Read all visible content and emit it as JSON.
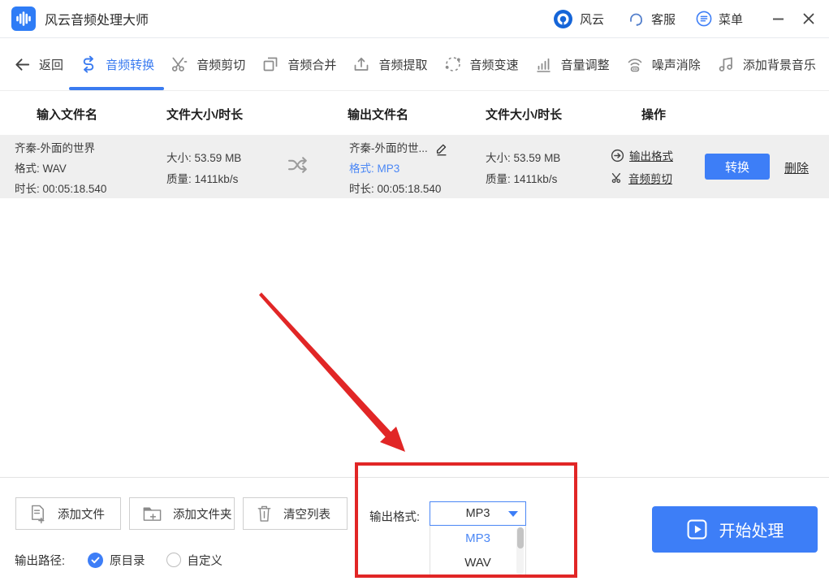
{
  "titlebar": {
    "app_title": "风云音频处理大师",
    "brand": "风云",
    "support": "客服",
    "menu": "菜单"
  },
  "tabs": {
    "back": "返回",
    "items": [
      {
        "label": "音频转换",
        "active": true
      },
      {
        "label": "音频剪切",
        "active": false
      },
      {
        "label": "音频合并",
        "active": false
      },
      {
        "label": "音频提取",
        "active": false
      },
      {
        "label": "音频变速",
        "active": false
      },
      {
        "label": "音量调整",
        "active": false
      },
      {
        "label": "噪声消除",
        "active": false
      },
      {
        "label": "添加背景音乐",
        "active": false
      }
    ]
  },
  "table": {
    "headers": [
      "输入文件名",
      "文件大小/时长",
      "输出文件名",
      "文件大小/时长",
      "操作"
    ],
    "row": {
      "input": {
        "name": "齐秦-外面的世界",
        "format_label": "格式:",
        "format": "WAV",
        "duration_label": "时长:",
        "duration": "00:05:18.540",
        "size_label": "大小:",
        "size": "53.59 MB",
        "quality_label": "质量:",
        "quality": "1411kb/s"
      },
      "output": {
        "name": "齐秦-外面的世...",
        "format_label": "格式:",
        "format": "MP3",
        "duration_label": "时长:",
        "duration": "00:05:18.540",
        "size_label": "大小:",
        "size": "53.59 MB",
        "quality_label": "质量:",
        "quality": "1411kb/s"
      },
      "actions": {
        "output_format": "输出格式",
        "audio_cut": "音频剪切",
        "convert": "转换",
        "delete": "删除"
      }
    }
  },
  "footer": {
    "add_file": "添加文件",
    "add_folder": "添加文件夹",
    "clear_list": "清空列表",
    "output_format_label": "输出格式:",
    "dropdown": {
      "selected": "MP3",
      "options": [
        {
          "label": "MP3",
          "selected": true
        },
        {
          "label": "WAV",
          "selected": false
        }
      ]
    },
    "start": "开始处理",
    "output_path_label": "输出路径:",
    "path_original": "原目录",
    "path_custom": "自定义"
  },
  "colors": {
    "accent": "#3D7EF7",
    "link_blue": "#4B87F5",
    "annotation_red": "#E12626",
    "row_bg": "#EFEFEF"
  }
}
